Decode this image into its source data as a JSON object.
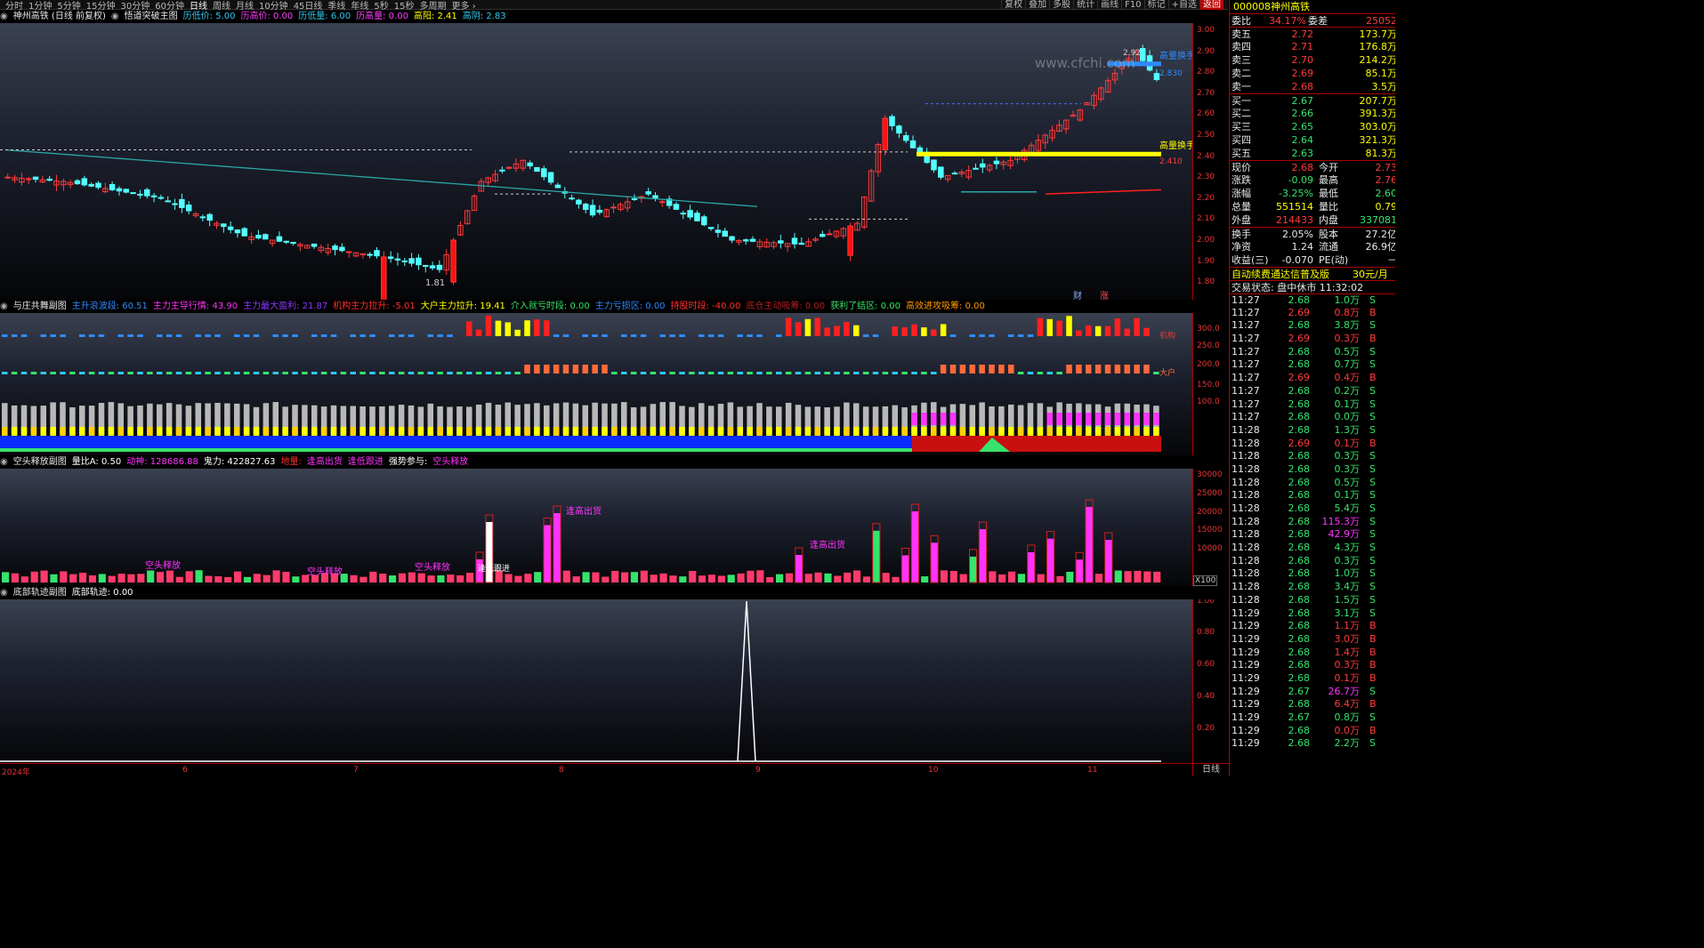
{
  "toolbar": {
    "periods": [
      "分时",
      "1分钟",
      "5分钟",
      "15分钟",
      "30分钟",
      "60分钟",
      "日线",
      "周线",
      "月线",
      "10分钟",
      "45日线",
      "季线",
      "年线",
      "5秒",
      "15秒",
      "多周期",
      "更多 ›"
    ],
    "selected": "日线",
    "right": [
      "复权",
      "叠加",
      "多股",
      "统计",
      "画线",
      "F10",
      "标记",
      "+自选",
      "返回"
    ]
  },
  "main_title": {
    "stock": "神州高铁 (日线 前复权)",
    "indicator": "悟道突破主图",
    "items": [
      {
        "t": "历低价: 5.00",
        "c": "#2ec8f0"
      },
      {
        "t": "历高价: 0.00",
        "c": "#ff3bff"
      },
      {
        "t": "历低量: 6.00",
        "c": "#2ec8f0"
      },
      {
        "t": "历高量: 0.00",
        "c": "#ff3bff"
      },
      {
        "t": "高阳: 2.41",
        "c": "#ffff00"
      },
      {
        "t": "高阴: 2.83",
        "c": "#2ec8f0"
      }
    ]
  },
  "main_axis": [
    "3.00",
    "2.90",
    "2.80",
    "2.70",
    "2.60",
    "2.50",
    "2.40",
    "2.30",
    "2.20",
    "2.10",
    "2.00",
    "1.90",
    "1.80"
  ],
  "main_labels": {
    "low": "1.81",
    "high": "2.92",
    "watermark": "www.cfchi.com",
    "tag1": "高量换手",
    "tag2": "高量换手",
    "price1": "2.830",
    "price2": "2.410",
    "bottom1": "财",
    "bottom2": "涨"
  },
  "p2_title": {
    "name": "与庄共舞副图",
    "items": [
      {
        "t": "主升浪波段: 60.51",
        "c": "#2e8cff"
      },
      {
        "t": "主力主导行情: 43.90",
        "c": "#ff33ff"
      },
      {
        "t": "主力最大盈利: 21.87",
        "c": "#8a3bff"
      },
      {
        "t": "机构主力拉升: -5.01",
        "c": "#ff3030"
      },
      {
        "t": "大户主力拉升: 19.41",
        "c": "#ffff00"
      },
      {
        "t": "介入就亏时段: 0.00",
        "c": "#36e36c"
      },
      {
        "t": "主力亏损区: 0.00",
        "c": "#2e8cff"
      },
      {
        "t": "持股时段: -40.00",
        "c": "#ff3030"
      },
      {
        "t": "底仓主动吸筹: 0.00",
        "c": "#b02020"
      },
      {
        "t": "获利了结区: 0.00",
        "c": "#36e36c"
      },
      {
        "t": "高效进攻吸筹: 0.00",
        "c": "#ff9a00"
      }
    ]
  },
  "p2_axis": [
    "300.0",
    "250.0",
    "200.0",
    "150.0",
    "100.0"
  ],
  "p2_labels": {
    "r1": "机构",
    "r2": "大户"
  },
  "p3_title": {
    "name": "空头释放副图",
    "items": [
      {
        "t": "量比A: 0.50",
        "c": "#ffffff"
      },
      {
        "t": "动神: 128686.88",
        "c": "#ff33ff"
      },
      {
        "t": "鬼力: 422827.63",
        "c": "#ffffff"
      },
      {
        "t": "地量:",
        "c": "#ff3030"
      },
      {
        "t": "逢高出货",
        "c": "#ff33ff"
      },
      {
        "t": "逢低跟进",
        "c": "#ff33ff"
      },
      {
        "t": "强势参与:",
        "c": "#ffffff"
      },
      {
        "t": "空头释放",
        "c": "#ff33ff"
      }
    ]
  },
  "p3_axis": [
    "30000",
    "25000",
    "20000",
    "15000",
    "10000"
  ],
  "p3_labels": {
    "x100": "X100",
    "k1": "空头释放",
    "k2": "空头释放",
    "k3": "空头释放",
    "g1": "逢高出货",
    "g2": "逢高出货",
    "g3": "逢低跟进"
  },
  "p4_title": {
    "name": "底部轨迹副图",
    "items": [
      {
        "t": "底部轨迹: 0.00",
        "c": "#ffffff"
      }
    ]
  },
  "p4_axis": [
    "1.00",
    "0.80",
    "0.60",
    "0.40",
    "0.20"
  ],
  "x_axis": [
    "2024年",
    "6",
    "7",
    "8",
    "9",
    "10",
    "11"
  ],
  "x_period": "日线",
  "quote": {
    "code": "000008",
    "name": "神州高铁",
    "wb_label": "委比",
    "wb": "34.17%",
    "wc_label": "委差",
    "wc": "25052",
    "sells": [
      {
        "l": "卖五",
        "p": "2.72",
        "v": "173.7万"
      },
      {
        "l": "卖四",
        "p": "2.71",
        "v": "176.8万"
      },
      {
        "l": "卖三",
        "p": "2.70",
        "v": "214.2万"
      },
      {
        "l": "卖二",
        "p": "2.69",
        "v": "85.1万"
      },
      {
        "l": "卖一",
        "p": "2.68",
        "v": "3.5万"
      }
    ],
    "buys": [
      {
        "l": "买一",
        "p": "2.67",
        "v": "207.7万"
      },
      {
        "l": "买二",
        "p": "2.66",
        "v": "391.3万"
      },
      {
        "l": "买三",
        "p": "2.65",
        "v": "303.0万"
      },
      {
        "l": "买四",
        "p": "2.64",
        "v": "321.3万"
      },
      {
        "l": "买五",
        "p": "2.63",
        "v": "81.3万"
      }
    ],
    "stats": [
      {
        "l1": "现价",
        "v1": "2.68",
        "c1": "up",
        "l2": "今开",
        "v2": "2.73",
        "c2": "up"
      },
      {
        "l1": "涨跌",
        "v1": "-0.09",
        "c1": "dn",
        "l2": "最高",
        "v2": "2.76",
        "c2": "up"
      },
      {
        "l1": "涨幅",
        "v1": "-3.25%",
        "c1": "dn",
        "l2": "最低",
        "v2": "2.60",
        "c2": "dn"
      },
      {
        "l1": "总量",
        "v1": "551514",
        "c1": "yl",
        "l2": "量比",
        "v2": "0.79",
        "c2": "yl"
      },
      {
        "l1": "外盘",
        "v1": "214433",
        "c1": "up",
        "l2": "内盘",
        "v2": "337081",
        "c2": "dn"
      },
      {
        "l1": "换手",
        "v1": "2.05%",
        "c1": "wh",
        "l2": "股本",
        "v2": "27.2亿",
        "c2": "wh"
      },
      {
        "l1": "净资",
        "v1": "1.24",
        "c1": "wh",
        "l2": "流通",
        "v2": "26.9亿",
        "c2": "wh"
      },
      {
        "l1": "收益(三)",
        "v1": "-0.070",
        "c1": "wh",
        "l2": "PE(动)",
        "v2": "－",
        "c2": "wh"
      }
    ],
    "promo": "自动续费通达信普及版",
    "promo_price": "30元/月",
    "status": "交易状态: 盘中休市 11:32:02",
    "ticks": [
      [
        "11:27",
        "2.68",
        "1.0万",
        "S"
      ],
      [
        "11:27",
        "2.69",
        "0.8万",
        "B"
      ],
      [
        "11:27",
        "2.68",
        "3.8万",
        "S"
      ],
      [
        "11:27",
        "2.69",
        "0.3万",
        "B"
      ],
      [
        "11:27",
        "2.68",
        "0.5万",
        "S"
      ],
      [
        "11:27",
        "2.68",
        "0.7万",
        "S"
      ],
      [
        "11:27",
        "2.69",
        "0.4万",
        "B"
      ],
      [
        "11:27",
        "2.68",
        "0.2万",
        "S"
      ],
      [
        "11:27",
        "2.68",
        "0.1万",
        "S"
      ],
      [
        "11:27",
        "2.68",
        "0.0万",
        "S"
      ],
      [
        "11:28",
        "2.68",
        "1.3万",
        "S"
      ],
      [
        "11:28",
        "2.69",
        "0.1万",
        "B"
      ],
      [
        "11:28",
        "2.68",
        "0.3万",
        "S"
      ],
      [
        "11:28",
        "2.68",
        "0.3万",
        "S"
      ],
      [
        "11:28",
        "2.68",
        "0.5万",
        "S"
      ],
      [
        "11:28",
        "2.68",
        "0.1万",
        "S"
      ],
      [
        "11:28",
        "2.68",
        "5.4万",
        "S"
      ],
      [
        "11:28",
        "2.68",
        "115.3万",
        "S"
      ],
      [
        "11:28",
        "2.68",
        "42.9万",
        "S"
      ],
      [
        "11:28",
        "2.68",
        "4.3万",
        "S"
      ],
      [
        "11:28",
        "2.68",
        "0.3万",
        "S"
      ],
      [
        "11:28",
        "2.68",
        "1.0万",
        "S"
      ],
      [
        "11:28",
        "2.68",
        "3.4万",
        "S"
      ],
      [
        "11:28",
        "2.68",
        "1.5万",
        "S"
      ],
      [
        "11:29",
        "2.68",
        "3.1万",
        "S"
      ],
      [
        "11:29",
        "2.68",
        "1.1万",
        "B"
      ],
      [
        "11:29",
        "2.68",
        "3.0万",
        "B"
      ],
      [
        "11:29",
        "2.68",
        "1.4万",
        "B"
      ],
      [
        "11:29",
        "2.68",
        "0.3万",
        "B"
      ],
      [
        "11:29",
        "2.68",
        "0.1万",
        "B"
      ],
      [
        "11:29",
        "2.67",
        "26.7万",
        "S"
      ],
      [
        "11:29",
        "2.68",
        "6.4万",
        "B"
      ],
      [
        "11:29",
        "2.67",
        "0.8万",
        "S"
      ],
      [
        "11:29",
        "2.68",
        "0.0万",
        "B"
      ],
      [
        "11:29",
        "2.68",
        "2.2万",
        "S"
      ]
    ]
  },
  "colors": {
    "up": "#ff3b3b",
    "down": "#54ffff",
    "green": "#36e36c",
    "yellow": "#ffff00",
    "magenta": "#ff33ff",
    "axis_red": "#aa0000"
  }
}
